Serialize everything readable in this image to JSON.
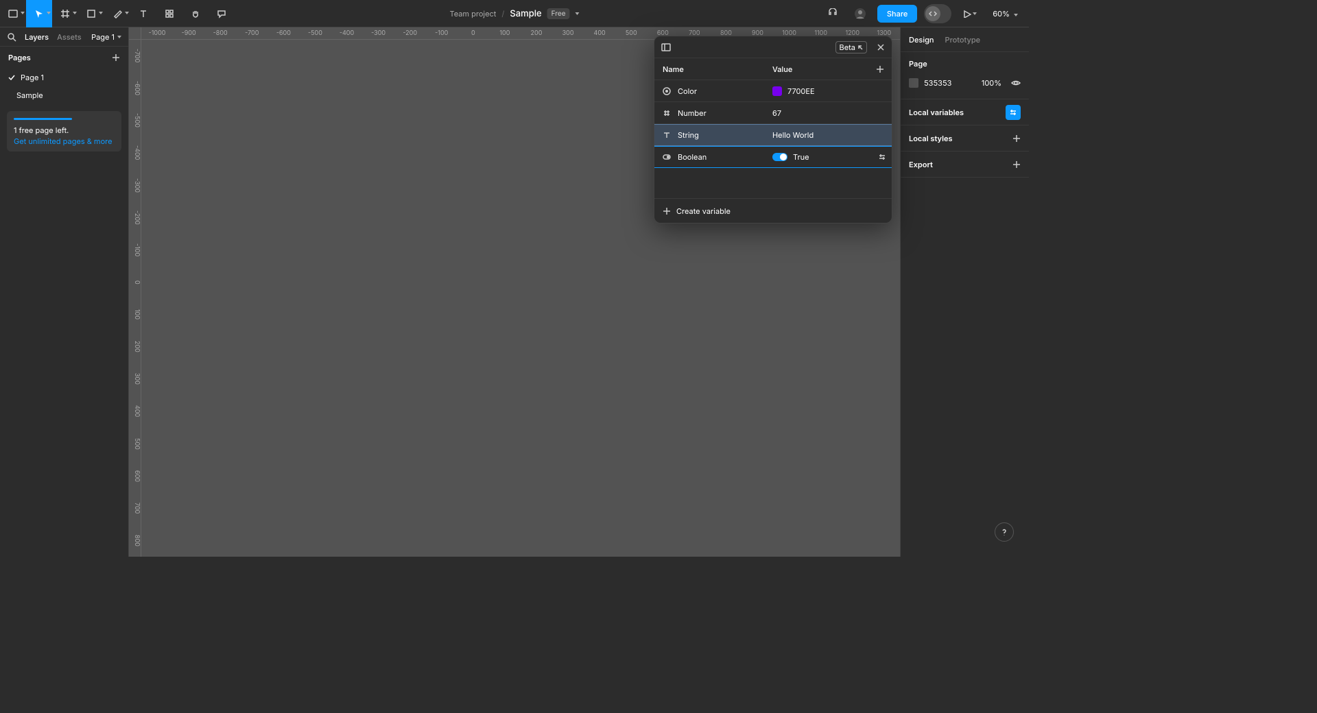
{
  "top": {
    "project": "Team project",
    "file": "Sample",
    "plan": "Free",
    "share": "Share",
    "zoom": "60%"
  },
  "left": {
    "tab_layers": "Layers",
    "tab_assets": "Assets",
    "page_dropdown": "Page 1",
    "pages_label": "Pages",
    "pages": [
      "Page 1"
    ],
    "layers": [
      "Sample"
    ],
    "promo_l1": "1 free page left.",
    "promo_l2": "Get unlimited pages & more"
  },
  "ruler_top": [
    "-1000",
    "-900",
    "-800",
    "-700",
    "-600",
    "-500",
    "-400",
    "-300",
    "-200",
    "-100",
    "0",
    "100",
    "200",
    "300",
    "400",
    "500",
    "600",
    "700",
    "800",
    "900",
    "1000",
    "1100",
    "1200",
    "1300"
  ],
  "ruler_left": [
    "-700",
    "-600",
    "-500",
    "-400",
    "-300",
    "-200",
    "-100",
    "0",
    "100",
    "200",
    "300",
    "400",
    "500",
    "600",
    "700",
    "800"
  ],
  "right": {
    "tab_design": "Design",
    "tab_prototype": "Prototype",
    "page_label": "Page",
    "bg_hex": "535353",
    "bg_pct": "100%",
    "local_vars": "Local variables",
    "local_styles": "Local styles",
    "export": "Export"
  },
  "modal": {
    "beta": "Beta",
    "col_name": "Name",
    "col_value": "Value",
    "rows": [
      {
        "type": "color",
        "name": "Color",
        "value": "7700EE",
        "swatch": "#7700EE"
      },
      {
        "type": "number",
        "name": "Number",
        "value": "67"
      },
      {
        "type": "string",
        "name": "String",
        "value": "Hello World"
      },
      {
        "type": "boolean",
        "name": "Boolean",
        "value": "True"
      }
    ],
    "create": "Create variable"
  }
}
